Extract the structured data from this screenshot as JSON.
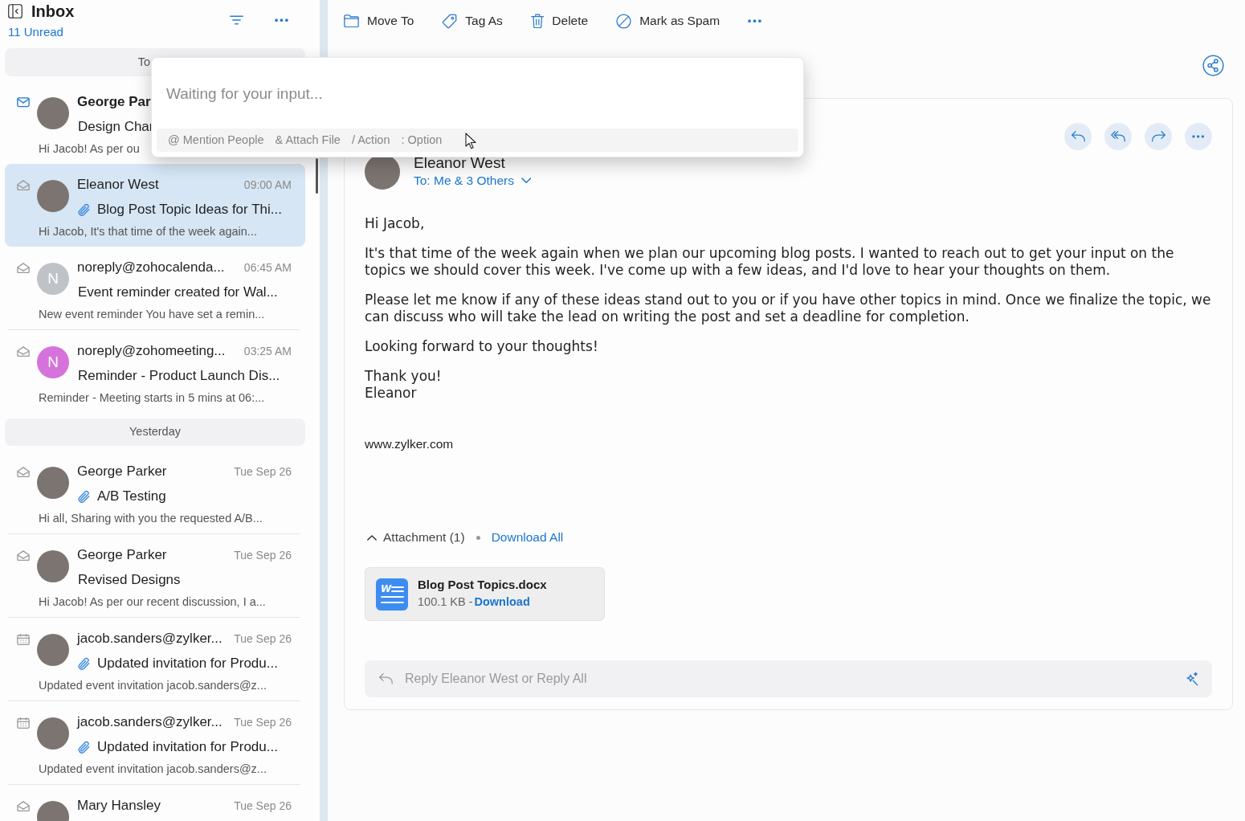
{
  "sidebar": {
    "title": "Inbox",
    "unread": "11 Unread",
    "groups": [
      {
        "label": "To",
        "items": [
          {
            "kind": "message",
            "unread": true,
            "selected": false,
            "sender": "George Par",
            "avatar": {
              "kind": "photo"
            },
            "has_attachment": false,
            "subject": "Design Char",
            "preview": "Hi Jacob! As per ou"
          },
          {
            "kind": "message",
            "unread": false,
            "selected": true,
            "sender": "Eleanor West",
            "time": "09:00 AM",
            "avatar": {
              "kind": "photo"
            },
            "has_attachment": true,
            "subject": "Blog Post Topic Ideas for Thi...",
            "preview": "Hi Jacob, It's that time of the week again..."
          },
          {
            "kind": "message",
            "unread": false,
            "selected": false,
            "sender": "noreply@zohocalenda...",
            "time": "06:45 AM",
            "avatar": {
              "kind": "initial",
              "initial": "N",
              "color": "#bfc3c8"
            },
            "has_attachment": false,
            "subject": "Event reminder created for Wal...",
            "preview": "New event reminder You have set a remin..."
          },
          {
            "kind": "message",
            "unread": false,
            "selected": false,
            "sender": "noreply@zohomeeting...",
            "time": "03:25 AM",
            "avatar": {
              "kind": "initial",
              "initial": "N",
              "color": "#d672dc"
            },
            "has_attachment": false,
            "subject": "Reminder - Product Launch Dis...",
            "preview": "Reminder - Meeting starts in 5 mins at 06:..."
          }
        ]
      },
      {
        "label": "Yesterday",
        "items": [
          {
            "kind": "message",
            "unread": false,
            "selected": false,
            "sender": "George Parker",
            "time": "Tue Sep 26",
            "avatar": {
              "kind": "photo"
            },
            "has_attachment": true,
            "subject": "A/B Testing",
            "preview": "Hi all, Sharing with you the requested A/B..."
          },
          {
            "kind": "message",
            "unread": false,
            "selected": false,
            "sender": "George Parker",
            "time": "Tue Sep 26",
            "avatar": {
              "kind": "photo"
            },
            "has_attachment": false,
            "subject": "Revised Designs",
            "preview": "Hi Jacob! As per our recent discussion, I a..."
          },
          {
            "kind": "invitation",
            "unread": false,
            "selected": false,
            "sender": "jacob.sanders@zylker...",
            "time": "Tue Sep 26",
            "avatar": {
              "kind": "photo"
            },
            "has_attachment": true,
            "subject": "Updated invitation for Produ...",
            "preview": "Updated event invitation jacob.sanders@z..."
          },
          {
            "kind": "invitation",
            "unread": false,
            "selected": false,
            "sender": "jacob.sanders@zylker...",
            "time": "Tue Sep 26",
            "avatar": {
              "kind": "photo"
            },
            "has_attachment": true,
            "subject": "Updated invitation for Produ...",
            "preview": "Updated event invitation jacob.sanders@z..."
          },
          {
            "kind": "message",
            "unread": false,
            "selected": false,
            "sender": "Mary Hansley",
            "time": "Tue Sep 26",
            "avatar": {
              "kind": "photo"
            }
          }
        ]
      }
    ]
  },
  "toolbar": {
    "actions": [
      {
        "kind": "move",
        "label": "Move To"
      },
      {
        "kind": "tag",
        "label": "Tag As"
      },
      {
        "kind": "delete",
        "label": "Delete"
      },
      {
        "kind": "spam",
        "label": "Mark as Spam"
      },
      {
        "kind": "more"
      }
    ]
  },
  "message": {
    "sender": "Eleanor West",
    "recipients": "To: Me & 3 Others",
    "avatar": {
      "kind": "photo"
    },
    "actions": [
      {
        "kind": "reply"
      },
      {
        "kind": "reply_all"
      },
      {
        "kind": "forward"
      },
      {
        "kind": "more"
      }
    ],
    "paragraphs": [
      "Hi Jacob,",
      "It's that time of the week again when we plan our upcoming blog posts. I wanted to reach out to get your input on the topics we should cover this week. I've come up with a few ideas, and I'd love to hear your thoughts on them.",
      "Please let me know if any of these ideas stand out to you or if you have other topics in mind. Once we finalize the topic, we can discuss who will take the lead on writing the post and set a deadline for completion.",
      "Looking forward to your thoughts!",
      "Thank you!\nEleanor"
    ],
    "signature": "www.zylker.com",
    "attachments": {
      "expanded": true,
      "label": "Attachment (1)",
      "download_all": "Download All",
      "files": [
        {
          "kind": "docx",
          "icon_letter": "W",
          "name": "Blog Post Topics.docx",
          "size": "100.1 KB -",
          "download": "Download"
        }
      ]
    },
    "reply": {
      "placeholder": "Reply Eleanor West or Reply All"
    }
  },
  "popup": {
    "placeholder": "Waiting for your input...",
    "hints": [
      "@ Mention People",
      "& Attach File",
      "/ Action",
      ": Option"
    ]
  }
}
